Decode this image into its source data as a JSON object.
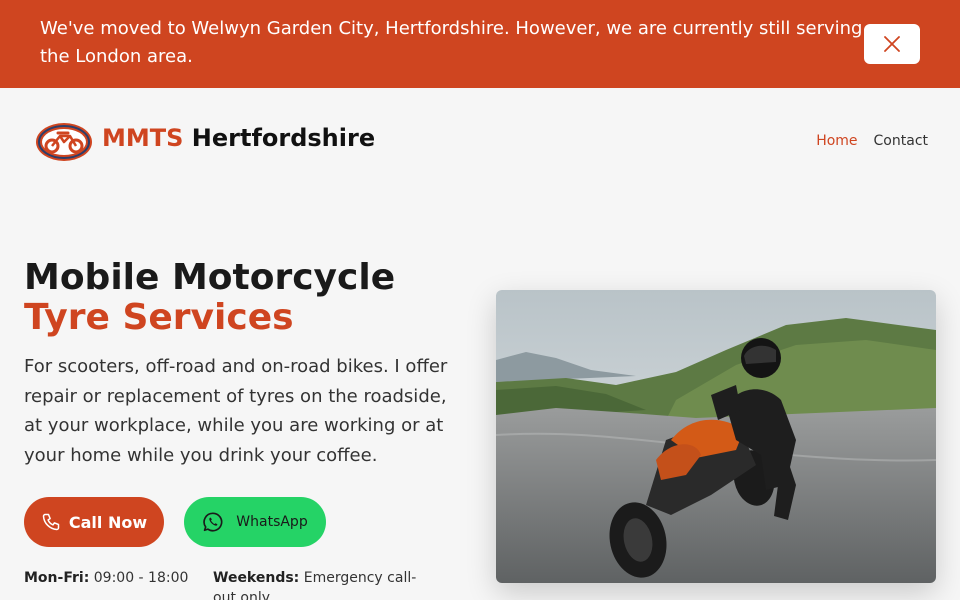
{
  "colors": {
    "brand": "#cf4520",
    "whatsapp": "#25d366",
    "background": "#f6f6f6"
  },
  "banner": {
    "message": "We've moved to Welwyn Garden City, Hertfordshire. However, we are currently still serving the London area.",
    "close_icon": "close-icon"
  },
  "header": {
    "brand_accent": "MMTS",
    "brand_name": "Hertfordshire",
    "logo_icon": "motorcycle-logo-icon",
    "nav": [
      {
        "label": "Home",
        "active": true
      },
      {
        "label": "Contact",
        "active": false
      }
    ]
  },
  "hero": {
    "title_line1": "Mobile Motorcycle",
    "title_line2": "Tyre Services",
    "description": "For scooters, off-road and on-road bikes. I offer repair or replacement of tyres on the roadside, at your workplace, while you are working or at your home while you drink your coffee.",
    "call_button": {
      "label": "Call Now",
      "icon": "phone-icon"
    },
    "whatsapp_button": {
      "label": "WhatsApp",
      "icon": "whatsapp-icon"
    },
    "hours": {
      "weekdays_label": "Mon-Fri:",
      "weekdays_value": "09:00 - 18:00",
      "weekends_label": "Weekends:",
      "weekends_value": "Emergency call-out only"
    },
    "image_subject": "rider-on-orange-motorcycle-photo"
  }
}
